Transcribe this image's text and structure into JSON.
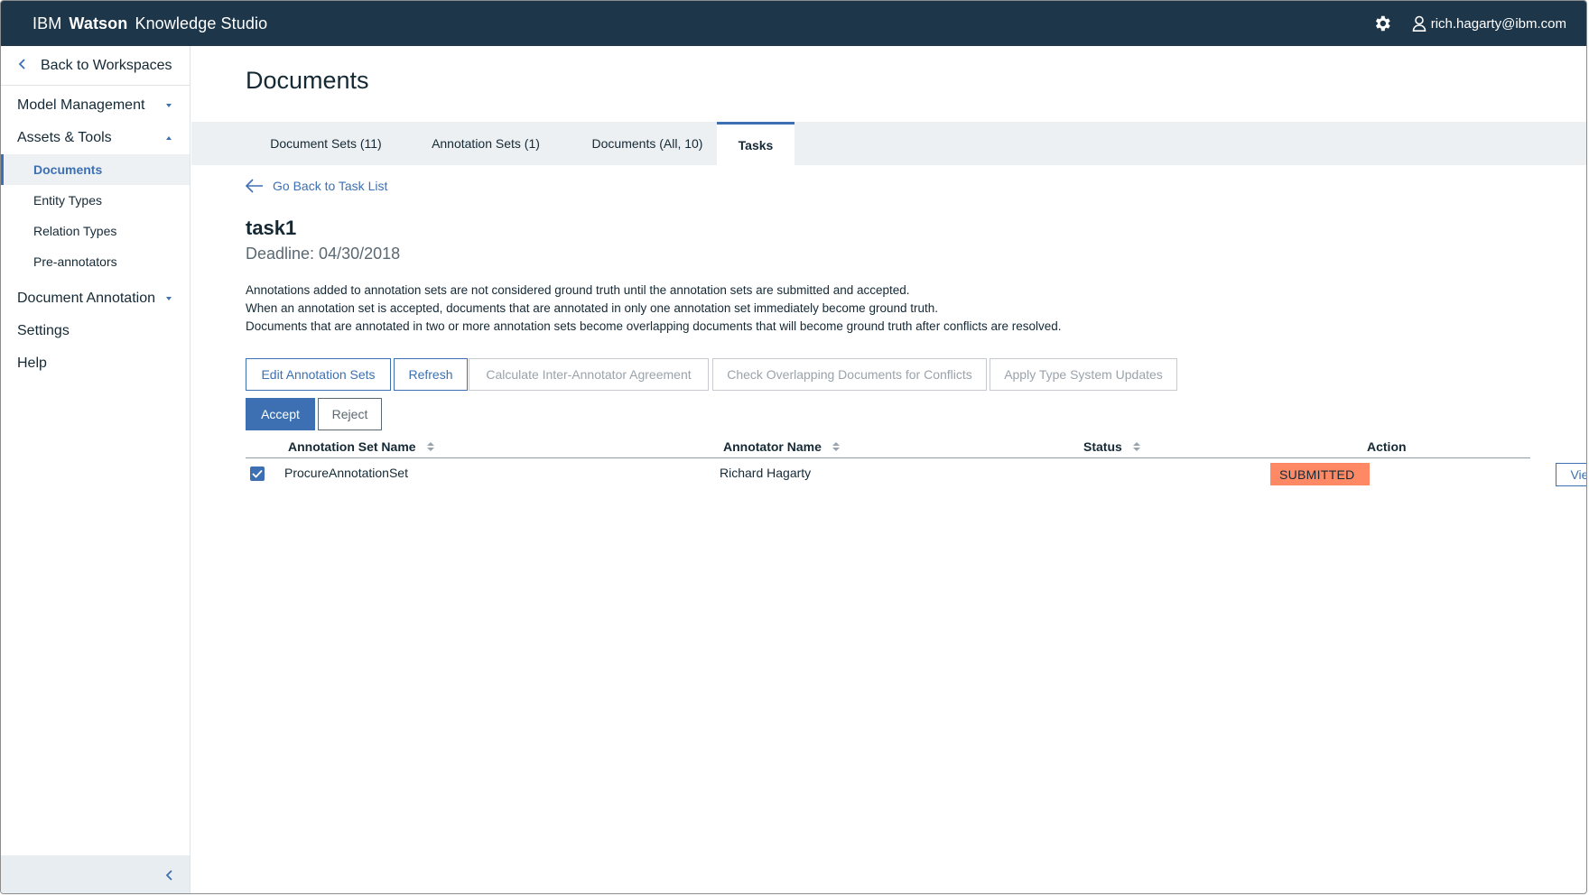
{
  "header": {
    "brand_part1": "IBM",
    "brand_part2": "Watson",
    "brand_part3": "Knowledge Studio",
    "user_email": "rich.hagarty@ibm.com",
    "icons": [
      "gear-icon",
      "user-icon"
    ]
  },
  "sidebar": {
    "back_label": "Back to Workspaces",
    "sections": {
      "model_management": "Model Management",
      "assets_tools": "Assets & Tools",
      "document_annotation": "Document Annotation",
      "settings": "Settings",
      "help": "Help"
    },
    "assets_items": [
      "Documents",
      "Entity Types",
      "Relation Types",
      "Pre-annotators"
    ],
    "active_item": "Documents"
  },
  "main": {
    "page_title": "Documents",
    "tabs": [
      "Document Sets (11)",
      "Annotation Sets (1)",
      "Documents (All, 10)",
      "Tasks"
    ],
    "active_tab": "Tasks",
    "back_link": "Go Back to Task List",
    "task_name": "task1",
    "deadline": "Deadline: 04/30/2018",
    "description": [
      "Annotations added to annotation sets are not considered ground truth until the annotation sets are submitted and accepted.",
      "When an annotation set is accepted, documents that are annotated in only one annotation set immediately become ground truth.",
      "Documents that are annotated in two or more annotation sets become overlapping documents that will become ground truth after conflicts are resolved."
    ],
    "buttons": {
      "edit_sets": "Edit Annotation Sets",
      "refresh": "Refresh",
      "calc_iaa": "Calculate Inter-Annotator Agreement",
      "check_overlap": "Check Overlapping Documents for Conflicts",
      "apply_updates": "Apply Type System Updates",
      "accept": "Accept",
      "reject": "Reject"
    },
    "table": {
      "headers": [
        "Annotation Set Name",
        "Annotator Name",
        "Status",
        "Action"
      ],
      "rows": [
        {
          "checked": true,
          "set_name": "ProcureAnnotationSet",
          "annotator": "Richard Hagarty",
          "status": "SUBMITTED",
          "action": "View"
        }
      ]
    }
  },
  "colors": {
    "header_bg": "#1d3649",
    "accent": "#3d70b2",
    "status_submitted": "#fe8964",
    "tab_bar": "#edf0f2"
  }
}
